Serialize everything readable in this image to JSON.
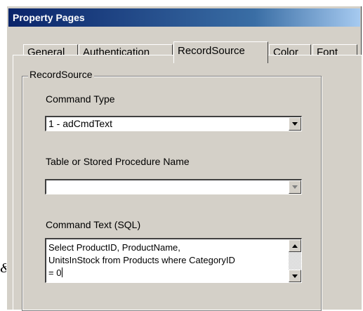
{
  "window": {
    "title": "Property Pages"
  },
  "tabs": [
    {
      "label": "General"
    },
    {
      "label": "Authentication"
    },
    {
      "label": "RecordSource",
      "active": true
    },
    {
      "label": "Color"
    },
    {
      "label": "Font"
    }
  ],
  "group": {
    "title": "RecordSource"
  },
  "command_type": {
    "label": "Command Type",
    "value": "1 - adCmdText"
  },
  "table_name": {
    "label": "Table or Stored Procedure Name",
    "value": ""
  },
  "command_text": {
    "label": "Command Text (SQL)",
    "line1": "Select ProductID, ProductName,",
    "line2": "UnitsInStock from Products where CategoryID",
    "line3": "= 0"
  },
  "stray_char": "&"
}
